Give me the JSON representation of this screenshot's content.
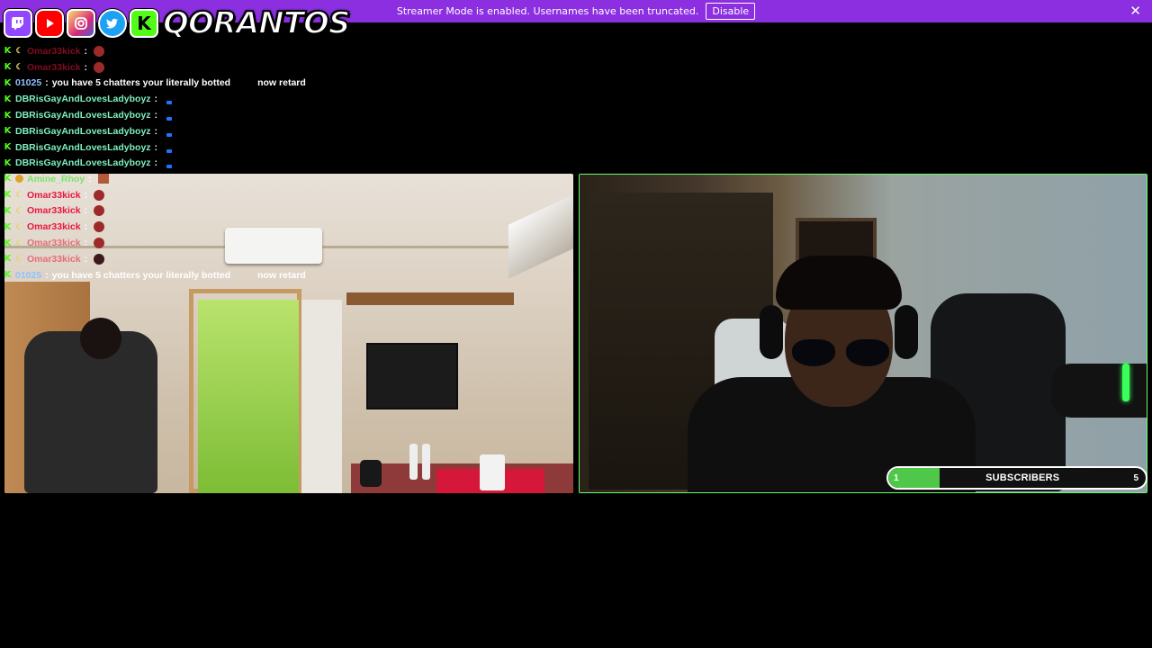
{
  "banner": {
    "message": "Streamer Mode is enabled. Usernames have been truncated.",
    "disable_label": "Disable",
    "close_label": "✕"
  },
  "branding": {
    "name": "QORANTOS",
    "social_icons": [
      "twitch-icon",
      "youtube-icon",
      "instagram-icon",
      "twitter-icon",
      "kick-icon"
    ]
  },
  "chat_top": [
    {
      "user": "Omar33kick",
      "sep": ":",
      "text": "",
      "color": "#e8173d"
    },
    {
      "user": "Omar33kick",
      "sep": ":",
      "text": "",
      "color": "#e8173d"
    },
    {
      "user": "01025",
      "sep": ":",
      "text": "you have 5 chatters your literally botted",
      "suffix": "now retard",
      "color": "#8fc2ff"
    },
    {
      "user": "DBRisGayAndLovesLadyboyz",
      "sep": ":",
      "text": "",
      "color": "#7ef0c0"
    },
    {
      "user": "DBRisGayAndLovesLadyboyz",
      "sep": ":",
      "text": "",
      "color": "#7ef0c0"
    },
    {
      "user": "DBRisGayAndLovesLadyboyz",
      "sep": ":",
      "text": "",
      "color": "#7ef0c0"
    },
    {
      "user": "DBRisGayAndLovesLadyboyz",
      "sep": ":",
      "text": "",
      "color": "#7ef0c0"
    },
    {
      "user": "DBRisGayAndLovesLadyboyz",
      "sep": ":",
      "text": "",
      "color": "#7ef0c0"
    }
  ],
  "chat_bottom": [
    {
      "user": "Amine_Rhoy",
      "sep": ":",
      "text": "",
      "color": "#7be36a"
    },
    {
      "user": "Omar33kick",
      "sep": ":",
      "text": "",
      "color": "#e8173d"
    },
    {
      "user": "Omar33kick",
      "sep": ":",
      "text": "",
      "color": "#e8173d"
    },
    {
      "user": "Omar33kick",
      "sep": ":",
      "text": "",
      "color": "#e8173d"
    },
    {
      "user": "Omar33kick",
      "sep": ":",
      "text": "",
      "color": "#e8173d"
    },
    {
      "user": "Omar33kick",
      "sep": ":",
      "text": "",
      "color": "#e8173d"
    },
    {
      "user": "01025",
      "sep": ":",
      "text": "you have 5 chatters your literally botted",
      "suffix": "now retard",
      "color": "#8fc2ff"
    }
  ],
  "subscribers": {
    "label": "SUBSCRIBERS",
    "current": "1",
    "goal": "5",
    "progress": 0.2,
    "fill_color": "#4fc84a"
  }
}
